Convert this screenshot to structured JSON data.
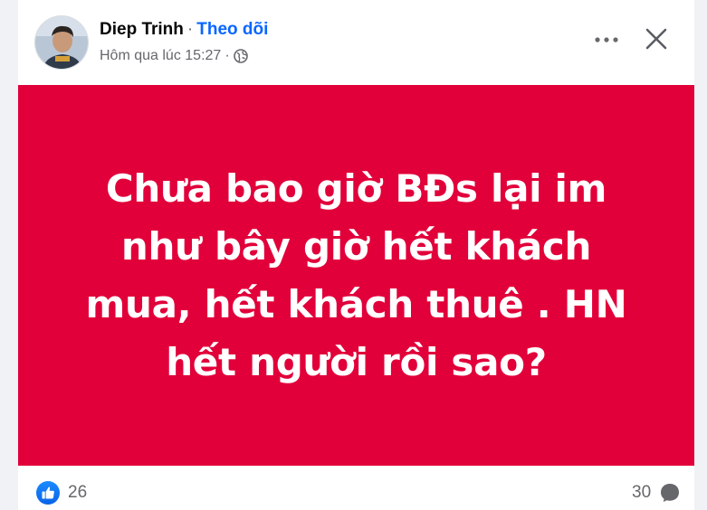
{
  "post": {
    "author_name": "Diep Trinh",
    "separator": "·",
    "follow_label": "Theo dõi",
    "timestamp": "Hôm qua lúc 15:27",
    "meta_separator": "·",
    "privacy_icon": "globe-icon",
    "more_icon": "more-horizontal-icon",
    "close_icon": "close-icon",
    "image_background": "#e1003a",
    "image_text": "Chưa bao giờ BĐs lại im như bây giờ hết khách mua, hết khách thuê . HN hết người rồi sao?",
    "reactions": {
      "like_icon": "like-icon",
      "like_count": "26",
      "comment_count": "30",
      "comment_icon": "comment-icon"
    }
  },
  "colors": {
    "link_blue": "#0866ff",
    "secondary_text": "#65676b",
    "primary_text": "#050505"
  }
}
